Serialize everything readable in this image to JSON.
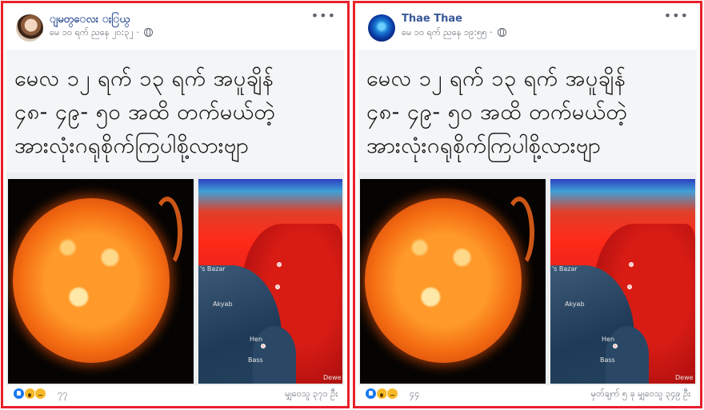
{
  "posts": [
    {
      "author": "ျမတ္ေလး ႏြယ္",
      "timestamp": "မေ ၁၀ ရက် ညနေ ၂၀:၃၂ ·",
      "caption_lines": [
        "မေလ ၁၂ ရက် ၁၃ ရက် အပူချိန်",
        "၄၈- ၄၉- ၅၀ အထိ တက်မယ်တဲ့",
        "အားလုံးဂရုစိုက်ကြပါစို့လားဗျာ"
      ],
      "map_labels": [
        "'s Bazar",
        "Akyab",
        "Bass",
        "Dewe",
        "Hen"
      ],
      "reaction_count": "၇၇",
      "footer_right": "မျှဝေသူ ၃၇၁ ဦး"
    },
    {
      "author": "Thae Thae",
      "timestamp": "မေ ၁၀ ရက် ညနေ ၁၉:၅၅ ·",
      "caption_lines": [
        "မေလ ၁၂ ရက် ၁၃ ရက် အပူချိန်",
        "၄၈- ၄၉- ၅၀ အထိ တက်မယ်တဲ့",
        "အားလုံးဂရုစိုက်ကြပါစို့လားဗျာ"
      ],
      "map_labels": [
        "'s Bazar",
        "Akyab",
        "Bass",
        "Dewe",
        "Hen"
      ],
      "reaction_count": "၄၄",
      "footer_right": "မှတ်ချက် ၅ ခု မျှဝေသူ ၃၄၉ ဦး"
    }
  ],
  "colors": {
    "border": "#e8202a",
    "author": "#385898",
    "meta": "#606770"
  },
  "icons": [
    "more-icon",
    "globe-icon",
    "like-icon",
    "wow-icon",
    "sad-icon"
  ]
}
